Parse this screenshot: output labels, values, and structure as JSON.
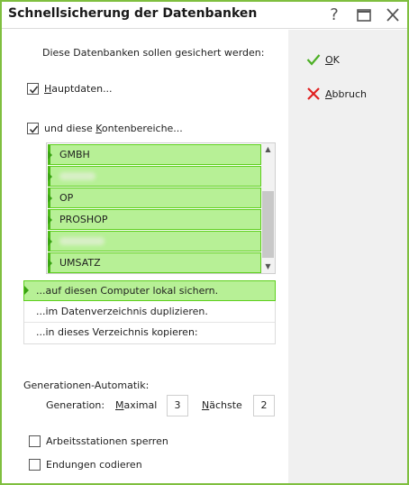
{
  "window": {
    "title": "Schnellsicherung der Datenbanken"
  },
  "titlebar": {
    "help": "?",
    "maximize": "maximize",
    "close": "close"
  },
  "main": {
    "header": "Diese Datenbanken sollen gesichert werden:",
    "hauptdaten": {
      "label_mn": "H",
      "label_rest": "auptdaten...",
      "checked": true
    },
    "konten": {
      "label_pre": "und diese ",
      "label_mn": "K",
      "label_rest": "ontenbereiche...",
      "checked": true
    },
    "list": [
      "GMBH",
      "",
      "OP",
      "PROSHOP",
      "",
      "UMSATZ"
    ],
    "targets": [
      "...auf diesen Computer lokal sichern.",
      "...im Datenverzeichnis duplizieren.",
      "...in dieses Verzeichnis kopieren:"
    ],
    "generationen": {
      "title": "Generationen-Automatik:",
      "generation_label": "Generation:",
      "maximal_mn": "M",
      "maximal_rest": "aximal",
      "maximal_value": "3",
      "naechste_mn": "N",
      "naechste_rest": "ächste",
      "naechste_value": "2"
    },
    "sperren": {
      "label": "Arbeitsstationen sperren",
      "checked": false
    },
    "codieren": {
      "label": "Endungen codieren",
      "checked": false
    }
  },
  "actions": {
    "ok_mn": "O",
    "ok_rest": "K",
    "abbruch_mn": "A",
    "abbruch_rest": "bbruch",
    "colors": {
      "ok": "#4caf24",
      "cancel": "#e02020",
      "accent": "#7fbf3f",
      "selection": "#b7f096"
    }
  }
}
